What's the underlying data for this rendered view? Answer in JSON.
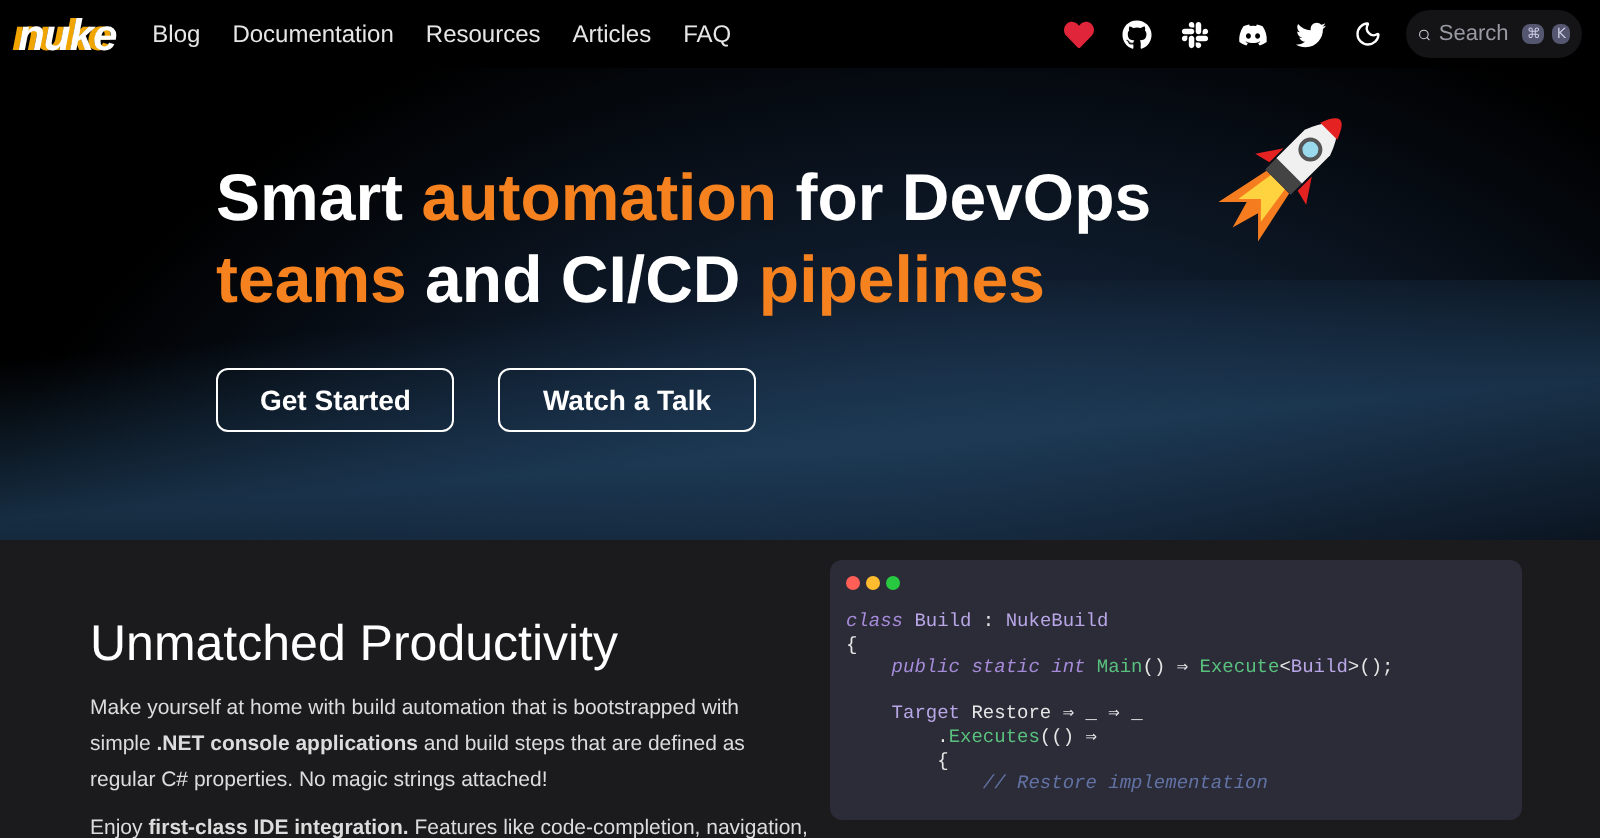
{
  "navbar": {
    "logo": "nuke",
    "links": [
      "Blog",
      "Documentation",
      "Resources",
      "Articles",
      "FAQ"
    ],
    "search": {
      "placeholder": "Search",
      "keys": [
        "⌘",
        "K"
      ]
    }
  },
  "hero": {
    "title_lines": [
      [
        {
          "text": "Smart ",
          "accent": false
        },
        {
          "text": "automation",
          "accent": true
        },
        {
          "text": " for DevOps",
          "accent": false
        }
      ],
      [
        {
          "text": "teams",
          "accent": true
        },
        {
          "text": " and CI/CD ",
          "accent": false
        },
        {
          "text": "pipelines",
          "accent": true
        }
      ]
    ],
    "buttons": [
      "Get Started",
      "Watch a Talk"
    ]
  },
  "section": {
    "heading": "Unmatched Productivity",
    "paragraphs": [
      "Make yourself at home with build automation that is bootstrapped with simple **.NET console applications** and build steps that are defined as regular C# properties. No magic strings attached!",
      "Enjoy **first-class IDE integration.** Features like code-completion, navigation,"
    ],
    "code": [
      {
        "gap_before": false,
        "tokens": [
          {
            "text": "class",
            "kind": "keyword"
          },
          {
            "text": " Build",
            "kind": "type"
          },
          {
            "text": " : ",
            "kind": "plain"
          },
          {
            "text": "NukeBuild",
            "kind": "type"
          }
        ]
      },
      {
        "gap_before": false,
        "tokens": [
          {
            "text": "{",
            "kind": "plain"
          }
        ]
      },
      {
        "gap_before": false,
        "tokens": [
          {
            "text": "    public static int",
            "kind": "keyword"
          },
          {
            "text": " Main",
            "kind": "fn"
          },
          {
            "text": "() ⇒ ",
            "kind": "plain"
          },
          {
            "text": "Execute",
            "kind": "fn"
          },
          {
            "text": "<",
            "kind": "plain"
          },
          {
            "text": "Build",
            "kind": "type"
          },
          {
            "text": ">();",
            "kind": "plain"
          }
        ]
      },
      {
        "gap_before": true,
        "tokens": [
          {
            "text": "    Target",
            "kind": "type"
          },
          {
            "text": " Restore ⇒ _ ⇒ _",
            "kind": "plain"
          }
        ]
      },
      {
        "gap_before": false,
        "tokens": [
          {
            "text": "        .",
            "kind": "plain"
          },
          {
            "text": "Executes",
            "kind": "fn"
          },
          {
            "text": "(() ⇒",
            "kind": "plain"
          }
        ]
      },
      {
        "gap_before": false,
        "tokens": [
          {
            "text": "        {",
            "kind": "plain"
          }
        ]
      },
      {
        "gap_before": false,
        "tokens": [
          {
            "text": "            // Restore implementation",
            "kind": "comment"
          }
        ]
      }
    ]
  }
}
